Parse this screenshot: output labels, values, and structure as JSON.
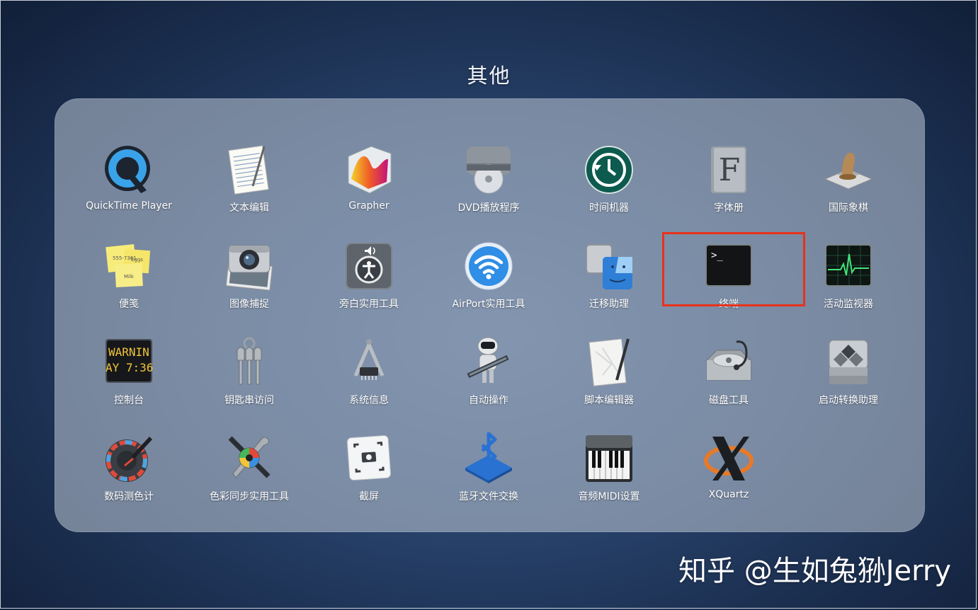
{
  "folder": {
    "title": "其他"
  },
  "apps": [
    {
      "label": "QuickTime Player",
      "icon": "quicktime-icon"
    },
    {
      "label": "文本编辑",
      "icon": "textedit-icon"
    },
    {
      "label": "Grapher",
      "icon": "grapher-icon"
    },
    {
      "label": "DVD播放程序",
      "icon": "dvd-player-icon"
    },
    {
      "label": "时间机器",
      "icon": "time-machine-icon"
    },
    {
      "label": "字体册",
      "icon": "font-book-icon"
    },
    {
      "label": "国际象棋",
      "icon": "chess-icon"
    },
    {
      "label": "便笺",
      "icon": "stickies-icon"
    },
    {
      "label": "图像捕捉",
      "icon": "image-capture-icon"
    },
    {
      "label": "旁白实用工具",
      "icon": "voiceover-utility-icon"
    },
    {
      "label": "AirPort实用工具",
      "icon": "airport-utility-icon"
    },
    {
      "label": "迁移助理",
      "icon": "migration-assistant-icon"
    },
    {
      "label": "终端",
      "icon": "terminal-icon",
      "highlighted": true
    },
    {
      "label": "活动监视器",
      "icon": "activity-monitor-icon"
    },
    {
      "label": "控制台",
      "icon": "console-icon",
      "icon_text_1": "WARNIN",
      "icon_text_2": "AY 7:36"
    },
    {
      "label": "钥匙串访问",
      "icon": "keychain-access-icon"
    },
    {
      "label": "系统信息",
      "icon": "system-information-icon"
    },
    {
      "label": "自动操作",
      "icon": "automator-icon"
    },
    {
      "label": "脚本编辑器",
      "icon": "script-editor-icon"
    },
    {
      "label": "磁盘工具",
      "icon": "disk-utility-icon"
    },
    {
      "label": "启动转换助理",
      "icon": "boot-camp-assistant-icon"
    },
    {
      "label": "数码测色计",
      "icon": "digital-color-meter-icon"
    },
    {
      "label": "色彩同步实用工具",
      "icon": "colorsync-utility-icon"
    },
    {
      "label": "截屏",
      "icon": "screenshot-icon"
    },
    {
      "label": "蓝牙文件交换",
      "icon": "bluetooth-file-exchange-icon"
    },
    {
      "label": "音频MIDI设置",
      "icon": "audio-midi-setup-icon"
    },
    {
      "label": "XQuartz",
      "icon": "xquartz-icon"
    }
  ],
  "terminal_prompt": ">_",
  "highlight_color": "#e8321c",
  "watermark": "知乎 @生如兔狲Jerry"
}
